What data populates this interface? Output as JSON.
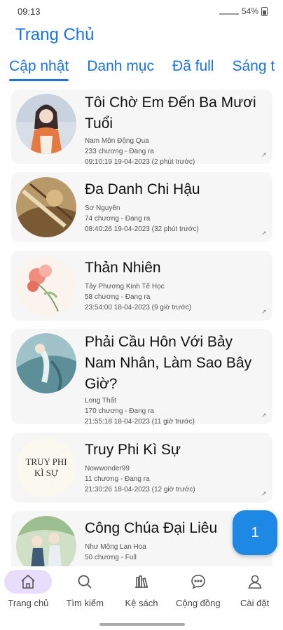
{
  "status": {
    "time": "09:13",
    "battery": "54%"
  },
  "header": {
    "title": "Trang Chủ"
  },
  "tabs": [
    {
      "label": "Cập nhật",
      "active": true
    },
    {
      "label": "Danh mục"
    },
    {
      "label": "Đã full"
    },
    {
      "label": "Sáng t"
    }
  ],
  "stories": [
    {
      "title_lines": [
        "Tôi Chờ Em Đến Ba Mươi",
        "Tuổi"
      ],
      "author": "Nam Môn Động Qua",
      "chapters": "233 chương - Đang ra",
      "updated": "09:10:19 19-04-2023 (2 phút trước)",
      "cover_icon": "girl-portrait-cover"
    },
    {
      "title_lines": [
        "Đa Danh Chi Hậu"
      ],
      "author": "Sơ Nguyên",
      "chapters": "74 chương - Đang ra",
      "updated": "08:40:26 19-04-2023 (32 phút trước)",
      "cover_icon": "ink-painting-cover"
    },
    {
      "title_lines": [
        "Thản Nhiên"
      ],
      "author": "Tây Phương Kinh Tế Học",
      "chapters": "58 chương - Đang ra",
      "updated": "23:54:00 18-04-2023 (9 giờ trước)",
      "cover_icon": "flower-cover"
    },
    {
      "title_lines": [
        "Phải Cầu Hôn Với Bảy",
        "Nam Nhân, Làm Sao Bây",
        "Giờ?"
      ],
      "author": "Long Thất",
      "chapters": "170 chương - Đang ra",
      "updated": "21:55:18 18-04-2023 (11 giờ trước)",
      "cover_icon": "blue-figure-cover"
    },
    {
      "title_lines": [
        "Truy Phi Kì Sự"
      ],
      "author": "Nowwonder99",
      "chapters": "11 chương - Đang ra",
      "updated": "21:30:26 18-04-2023 (12 giờ trước)",
      "cover_icon": "text-cover",
      "cover_text": [
        "TRUY PHI",
        "KÌ SỰ"
      ]
    },
    {
      "title_lines": [
        "Công Chúa Đại Liêu"
      ],
      "author": "Như Mộng Lan Hoa",
      "chapters": "50 chương - Full",
      "updated": "",
      "cover_icon": "couple-cover"
    }
  ],
  "fab": {
    "label": "1"
  },
  "nav": [
    {
      "label": "Trang chủ",
      "icon": "home-icon",
      "active": true
    },
    {
      "label": "Tìm kiếm",
      "icon": "search-icon"
    },
    {
      "label": "Kệ sách",
      "icon": "bookshelf-icon"
    },
    {
      "label": "Cộng đồng",
      "icon": "chat-icon"
    },
    {
      "label": "Cài đặt",
      "icon": "user-icon"
    }
  ],
  "colors": {
    "accent": "#1a73e8",
    "fab": "#1e88e5",
    "card": "#f6f6f6",
    "nav_active": "#e8defb"
  }
}
